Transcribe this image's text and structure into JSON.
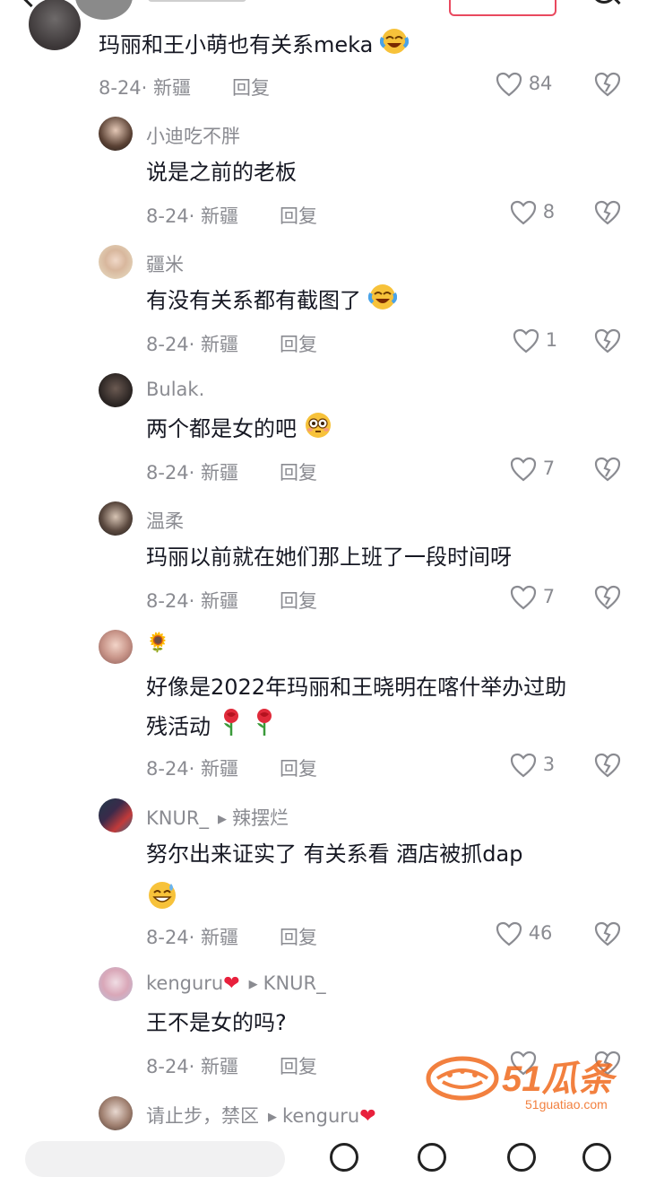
{
  "top_comment": {
    "text": "玛丽和王小萌也有关系meka",
    "date": "8-24",
    "location": "新疆",
    "reply_label": "回复",
    "likes": "84"
  },
  "replies": [
    {
      "user": "小迪吃不胖",
      "text": "说是之前的老板",
      "date": "8-24",
      "location": "新疆",
      "reply_label": "回复",
      "likes": "8"
    },
    {
      "user": "疆米",
      "text": "有没有关系都有截图了",
      "date": "8-24",
      "location": "新疆",
      "reply_label": "回复",
      "likes": "1"
    },
    {
      "user": "Bulak.",
      "text": "两个都是女的吧",
      "date": "8-24",
      "location": "新疆",
      "reply_label": "回复",
      "likes": "7"
    },
    {
      "user": "温柔",
      "text": "玛丽以前就在她们那上班了一段时间呀",
      "date": "8-24",
      "location": "新疆",
      "reply_label": "回复",
      "likes": "7"
    },
    {
      "user": "🌻",
      "text_line1": "好像是2022年玛丽和王晓明在喀什举办过助",
      "text_line2": "残活动",
      "date": "8-24",
      "location": "新疆",
      "reply_label": "回复",
      "likes": "3"
    },
    {
      "user": "KNUR_",
      "reply_to": "辣摆烂",
      "text": "努尔出来证实了  有关系看   酒店被抓dap",
      "date": "8-24",
      "location": "新疆",
      "reply_label": "回复",
      "likes": "46"
    },
    {
      "user": "kenguru",
      "reply_to": "KNUR_",
      "text": "王不是女的吗?",
      "date": "8-24",
      "location": "新疆",
      "reply_label": "回复",
      "likes": ""
    },
    {
      "user": "请止步，禁区",
      "reply_to": "kenguru"
    }
  ],
  "watermark": {
    "brand": "51瓜条",
    "url": "51guatiao.com"
  },
  "colors": {
    "text": "#161823",
    "secondary": "#8a8b91",
    "accent": "#e9495f",
    "watermark": "#f06a1e"
  }
}
